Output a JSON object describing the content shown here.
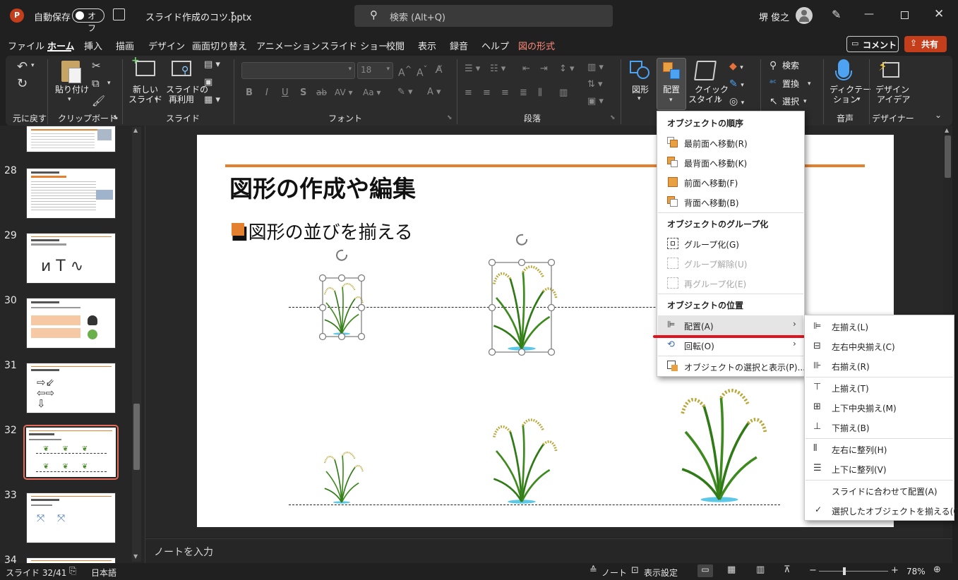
{
  "titlebar": {
    "autosave_label": "自動保存",
    "autosave_state": "オフ",
    "filename": "スライド作成のコツ.pptx",
    "search_placeholder": "検索 (Alt+Q)",
    "user_name": "堺 俊之"
  },
  "tabs": [
    "ファイル",
    "ホーム",
    "挿入",
    "描画",
    "デザイン",
    "画面切り替え",
    "アニメーション",
    "スライド ショー",
    "校閲",
    "表示",
    "録音",
    "ヘルプ",
    "図の形式"
  ],
  "actions": {
    "comment": "コメント",
    "share": "共有"
  },
  "ribbon": {
    "undo_group": "元に戻す",
    "paste": "貼り付け",
    "clipboard_group": "クリップボード",
    "new_slide": [
      "新しい",
      "スライド"
    ],
    "reuse_slide": [
      "スライドの",
      "再利用"
    ],
    "slide_group": "スライド",
    "font_size": "18",
    "font_group": "フォント",
    "paragraph_group": "段落",
    "shapes": "図形",
    "arrange": "配置",
    "quick_styles": [
      "クイック",
      "スタイル"
    ],
    "find": "検索",
    "replace": "置換",
    "select": "選択",
    "dictate": [
      "ディクテー",
      "ション"
    ],
    "voice_group": "音声",
    "design_ideas": [
      "デザイン",
      "アイデア"
    ],
    "designer_group": "デザイナー"
  },
  "slides_panel": {
    "numbers": [
      "28",
      "29",
      "30",
      "31",
      "32",
      "33",
      "34"
    ],
    "selected": "32"
  },
  "slide": {
    "title": "図形の作成や編集",
    "bullet": "■図形の並びを揃える",
    "accent_color": "#E4812F"
  },
  "notes_placeholder": "ノートを入力",
  "arrange_menu": {
    "order_header": "オブジェクトの順序",
    "order_items": [
      "最前面へ移動(R)",
      "最背面へ移動(K)",
      "前面へ移動(F)",
      "背面へ移動(B)"
    ],
    "group_header": "オブジェクトのグループ化",
    "group_items": [
      "グループ化(G)",
      "グループ解除(U)",
      "再グループ化(E)"
    ],
    "position_header": "オブジェクトの位置",
    "align": "配置(A)",
    "rotate": "回転(O)",
    "selection_pane": "オブジェクトの選択と表示(P)..."
  },
  "align_submenu": {
    "items": [
      "左揃え(L)",
      "左右中央揃え(C)",
      "右揃え(R)",
      "上揃え(T)",
      "上下中央揃え(M)",
      "下揃え(B)",
      "左右に整列(H)",
      "上下に整列(V)",
      "スライドに合わせて配置(A)",
      "選択したオブジェクトを揃える(O)"
    ]
  },
  "status": {
    "slide_info": "スライド 32/41",
    "language": "日本語",
    "notes": "ノート",
    "display_settings": "表示設定",
    "zoom": "78%"
  },
  "colors": {
    "share_button": "#C43E1C",
    "annotation_line": "#E0141E",
    "selection_border": "#E46C5A"
  }
}
